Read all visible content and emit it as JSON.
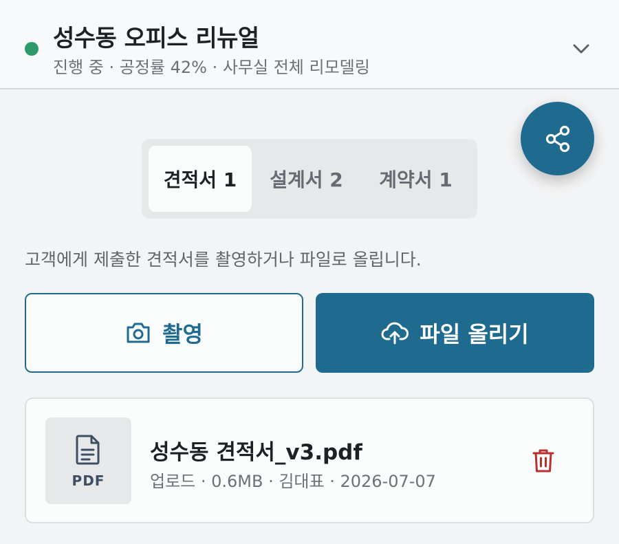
{
  "header": {
    "title": "성수동 오피스 리뉴얼",
    "meta": "진행 중 · 공정률 42% · 사무실 전체 리모델링",
    "status_color": "#2e9a6b"
  },
  "tabs": [
    {
      "label": "견적서 1",
      "active": true
    },
    {
      "label": "설계서 2",
      "active": false
    },
    {
      "label": "계약서 1",
      "active": false
    }
  ],
  "helper_text": "고객에게 제출한 견적서를 촬영하거나 파일로 올립니다.",
  "actions": {
    "camera_label": "촬영",
    "upload_label": "파일 올리기"
  },
  "file": {
    "type": "PDF",
    "name": "성수동 견적서_v3.pdf",
    "meta": "업로드 · 0.6MB · 김대표 · 2026-07-07"
  },
  "icons": {
    "status": "status-dot",
    "expand": "chevron-down-icon",
    "share": "share-icon",
    "camera": "camera-icon",
    "upload": "cloud-upload-icon",
    "document": "document-icon",
    "delete": "trash-icon"
  },
  "colors": {
    "accent": "#1f6a8f",
    "danger": "#b5322f"
  }
}
